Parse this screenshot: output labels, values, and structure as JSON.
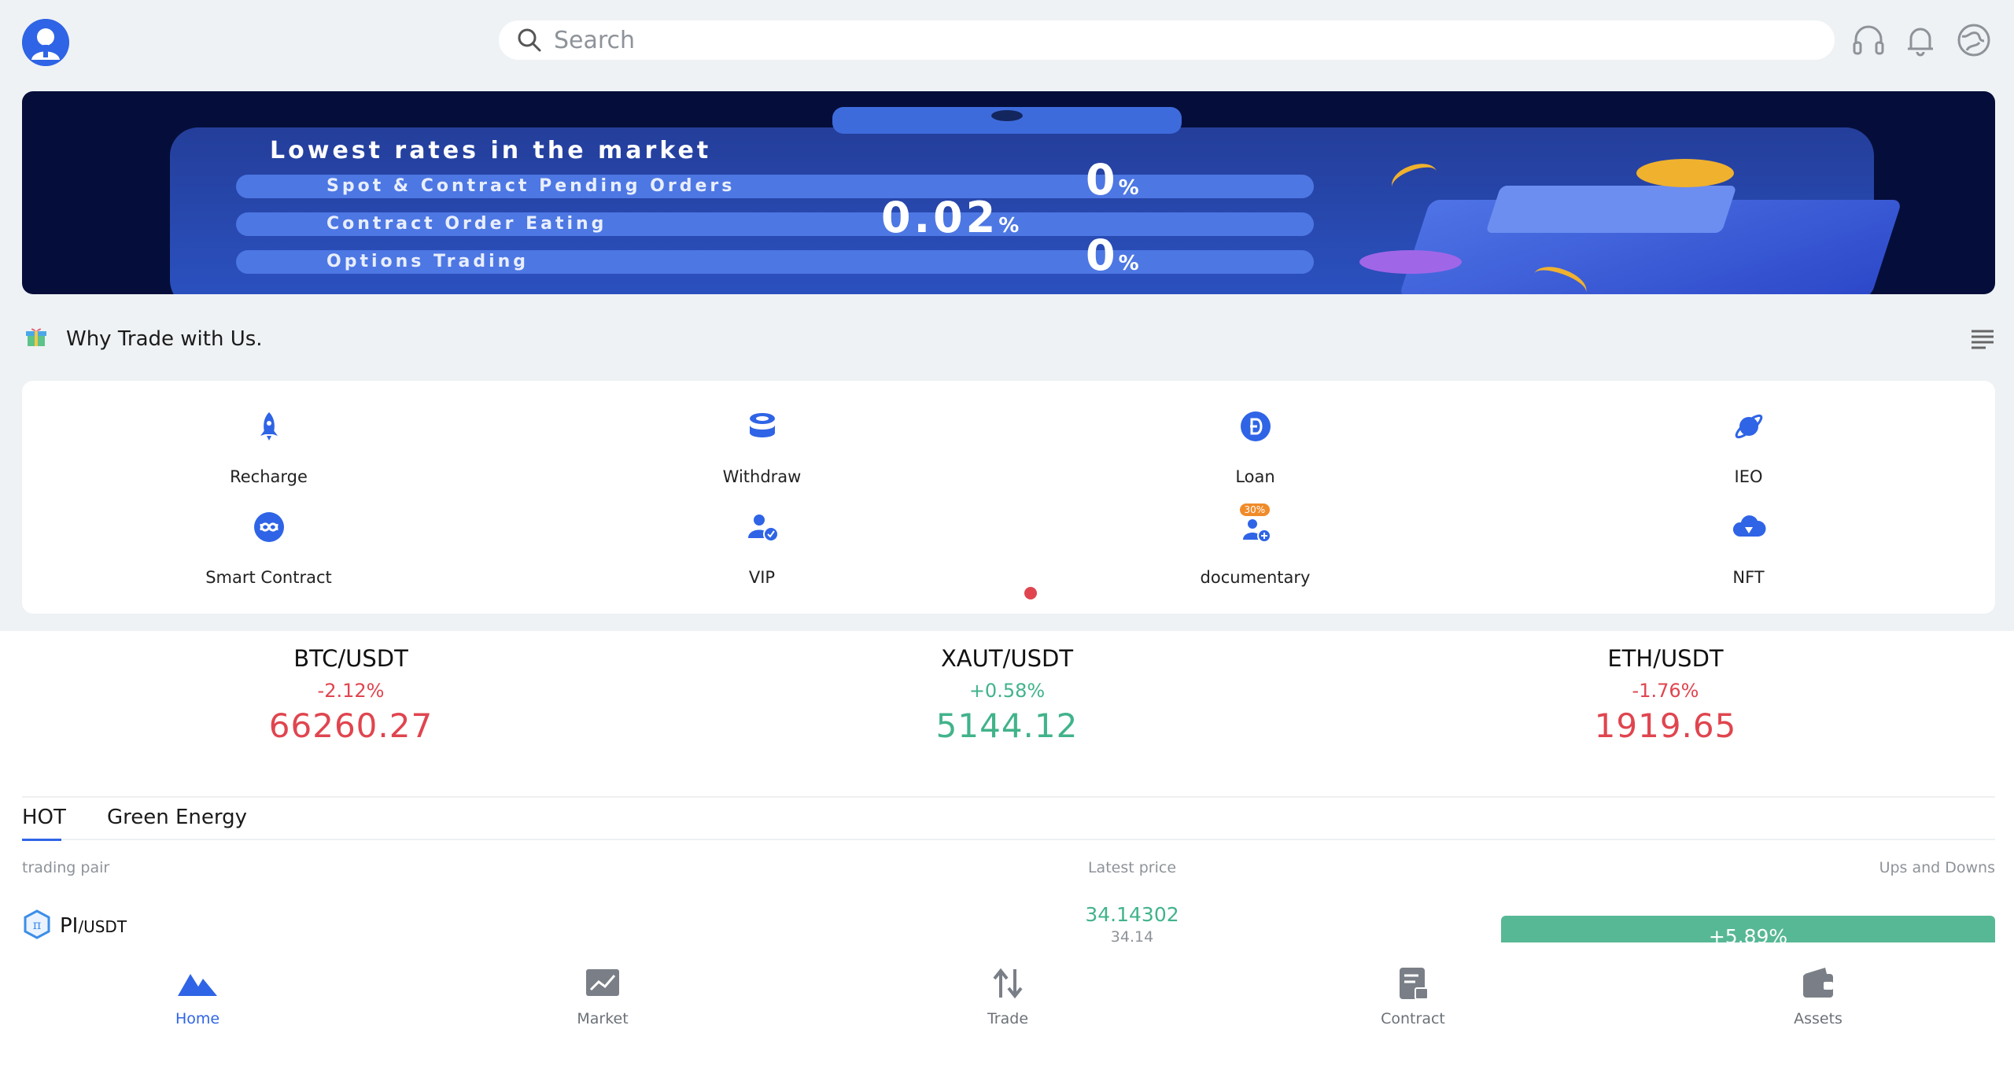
{
  "header": {
    "search_placeholder": "Search",
    "icons": [
      "avatar-icon",
      "headset-icon",
      "bell-icon",
      "globe-icon"
    ]
  },
  "banner": {
    "title": "Lowest rates in the market",
    "rows": [
      {
        "label": "Spot & Contract Pending Orders",
        "value": "0",
        "unit": "%"
      },
      {
        "label": "Contract Order Eating",
        "value": "0.02",
        "unit": "%"
      },
      {
        "label": "Options Trading",
        "value": "0",
        "unit": "%"
      }
    ]
  },
  "why": {
    "label": "Why Trade with Us."
  },
  "features": [
    {
      "label": "Recharge",
      "icon": "rocket-icon"
    },
    {
      "label": "Withdraw",
      "icon": "coins-icon"
    },
    {
      "label": "Loan",
      "icon": "dogecoin-icon"
    },
    {
      "label": "IEO",
      "icon": "planet-icon"
    },
    {
      "label": "Smart Contract",
      "icon": "smart-contract-icon"
    },
    {
      "label": "VIP",
      "icon": "vip-user-icon"
    },
    {
      "label": "documentary",
      "icon": "copy-trade-icon",
      "badge": "30%"
    },
    {
      "label": "NFT",
      "icon": "cloud-diamond-icon"
    }
  ],
  "tickers": [
    {
      "pair": "BTC/USDT",
      "change": "-2.12%",
      "price": "66260.27",
      "trend": "down"
    },
    {
      "pair": "XAUT/USDT",
      "change": "+0.58%",
      "price": "5144.12",
      "trend": "up"
    },
    {
      "pair": "ETH/USDT",
      "change": "-1.76%",
      "price": "1919.65",
      "trend": "down"
    }
  ],
  "tabs": [
    {
      "label": "HOT",
      "active": true
    },
    {
      "label": "Green Energy",
      "active": false
    }
  ],
  "table": {
    "headers": {
      "pair": "trading pair",
      "price": "Latest price",
      "change": "Ups and Downs"
    },
    "rows": [
      {
        "base": "PI",
        "quote": "/USDT",
        "price": "34.14302",
        "price_sub": "34.14",
        "change": "+5.89%"
      }
    ]
  },
  "nav": [
    {
      "label": "Home",
      "icon": "home-icon",
      "active": true
    },
    {
      "label": "Market",
      "icon": "market-chart-icon",
      "active": false
    },
    {
      "label": "Trade",
      "icon": "trade-arrows-icon",
      "active": false
    },
    {
      "label": "Contract",
      "icon": "contract-doc-icon",
      "active": false
    },
    {
      "label": "Assets",
      "icon": "wallet-icon",
      "active": false
    }
  ],
  "colors": {
    "accent": "#2f64e6",
    "down": "#e0454f",
    "up": "#41b38a",
    "background": "#eef2f4"
  }
}
